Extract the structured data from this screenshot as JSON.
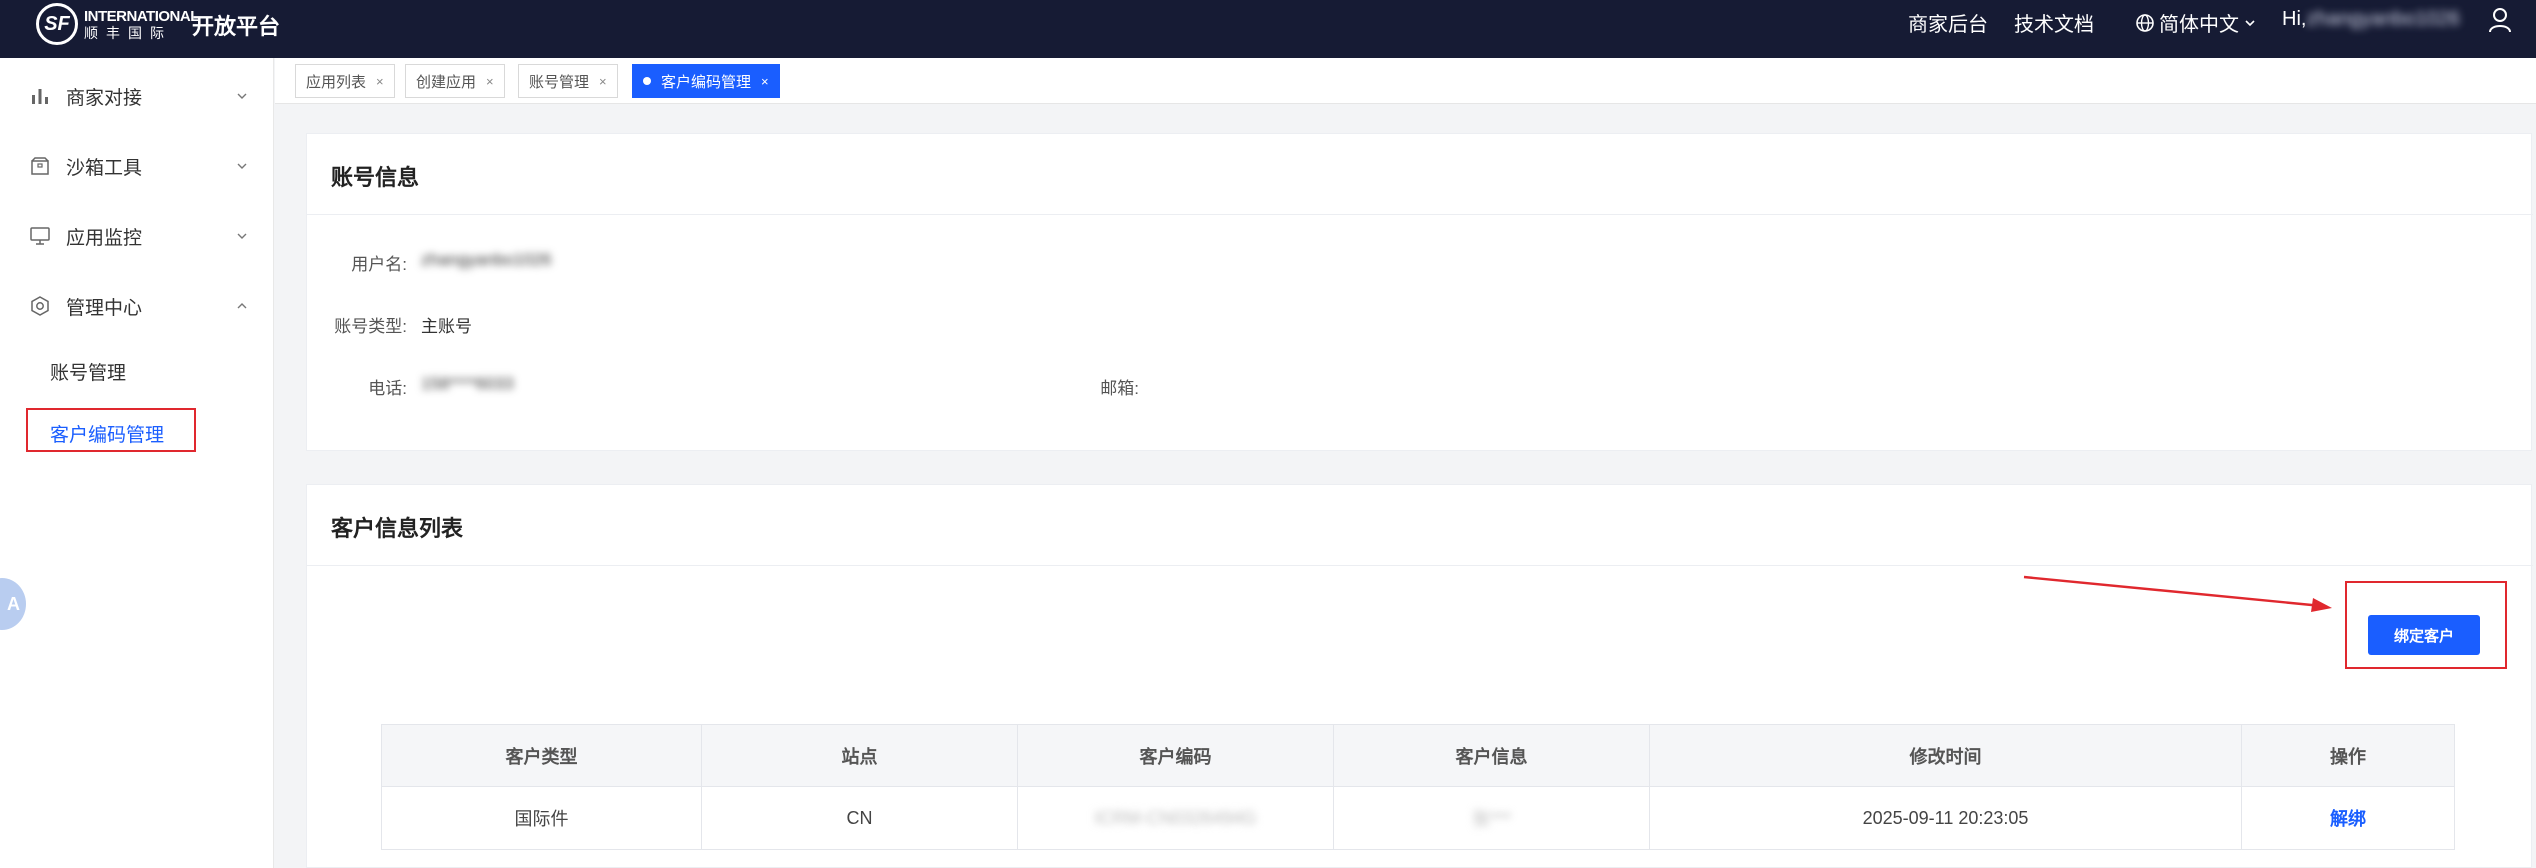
{
  "header": {
    "logo_mark": "SF",
    "logo_line1": "INTERNATIONAL",
    "logo_line2": "顺丰国际",
    "platform": "开放平台",
    "merchant": "商家后台",
    "docs": "技术文档",
    "language": "简体中文",
    "greeting": "Hi,",
    "username_blurred": "zhangyanbo1026"
  },
  "sidebar": {
    "items": [
      {
        "label": "商家对接",
        "icon": "bar-chart-icon"
      },
      {
        "label": "沙箱工具",
        "icon": "box-icon"
      },
      {
        "label": "应用监控",
        "icon": "monitor-icon"
      },
      {
        "label": "管理中心",
        "icon": "gear-icon"
      }
    ],
    "sub_items": [
      {
        "label": "账号管理"
      },
      {
        "label": "客户编码管理"
      }
    ],
    "bubble": "A"
  },
  "tabs": [
    {
      "label": "应用列表",
      "close": "×"
    },
    {
      "label": "创建应用",
      "close": "×"
    },
    {
      "label": "账号管理",
      "close": "×"
    },
    {
      "label": "客户编码管理",
      "close": "×"
    }
  ],
  "account": {
    "title": "账号信息",
    "username_label": "用户名:",
    "username_value": "zhangyanbo1026",
    "type_label": "账号类型:",
    "type_value": "主账号",
    "phone_label": "电话:",
    "phone_value": "158****6033",
    "email_label": "邮箱:",
    "email_value": ""
  },
  "customers": {
    "title": "客户信息列表",
    "bind_button": "绑定客户",
    "columns": [
      "客户类型",
      "站点",
      "客户编码",
      "客户信息",
      "修改时间",
      "操作"
    ],
    "rows": [
      {
        "type": "国际件",
        "site": "CN",
        "code": "ICRM-CN0326494G",
        "info": "张***",
        "modified": "2025-09-11 20:23:05",
        "action": "解绑"
      }
    ]
  },
  "colors": {
    "topbar": "#161b34",
    "accent": "#1a5eff",
    "annotation": "#e0282e"
  }
}
